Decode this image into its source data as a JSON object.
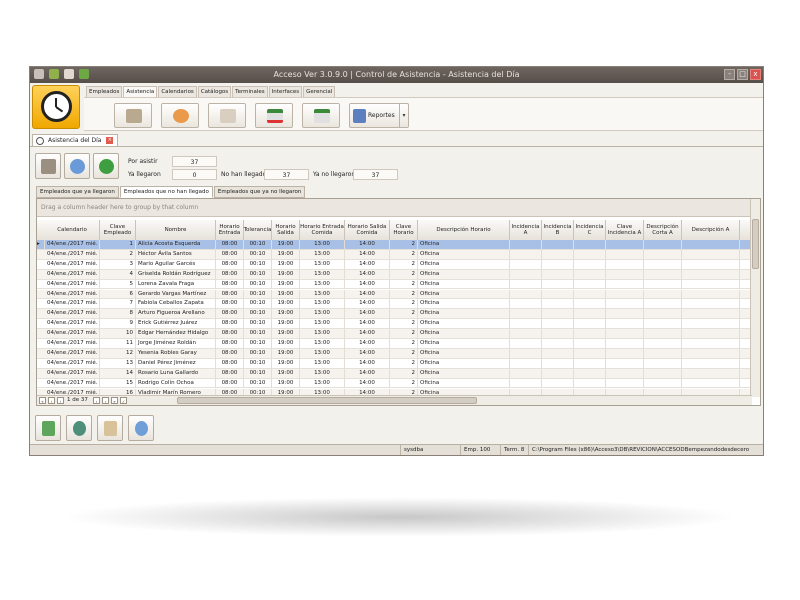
{
  "window": {
    "title": "Acceso Ver 3.0.9.0 | Control de Asistencia - Asistencia del Día",
    "controls": {
      "minimize": "-",
      "maximize": "□",
      "close": "x"
    }
  },
  "ribbon": {
    "tabs": [
      "Empleados",
      "Asistencia",
      "Calendarios",
      "Catálogos",
      "Terminales",
      "Interfaces",
      "Gerencial"
    ],
    "active_tab": "Asistencia",
    "reportes_label": "Reportes"
  },
  "doc_tab": {
    "label": "Asistencia del Día"
  },
  "stats": {
    "por_asistir_label": "Por asistir",
    "por_asistir_value": "37",
    "ya_llegaron_label": "Ya llegaron",
    "ya_llegaron_value": "0",
    "no_han_llegado_label": "No han llegado",
    "no_han_llegado_value": "37",
    "ya_no_llegaron_label": "Ya no llegaron",
    "ya_no_llegaron_value": "37"
  },
  "subtabs": [
    "Empleados que ya llegaron",
    "Empleados que no han llegado",
    "Empleados que ya no llegaron"
  ],
  "active_subtab": "Empleados que no han llegado",
  "grid": {
    "group_hint": "Drag a column header here to group by that column",
    "columns": [
      "Calendario",
      "Clave Empleado",
      "Nombre",
      "Horario Entrada",
      "Tolerancia",
      "Horario Salida",
      "Horario Entrada Comida",
      "Horario Salida Comida",
      "Clave Horario",
      "Descripción Horario",
      "Incidencia A",
      "Incidencia B",
      "Incidencia C",
      "Clave Incidencia A",
      "Descripción Corta A",
      "Descripción A"
    ],
    "rows": [
      [
        "04/ene./2017 mié.",
        "1",
        "Alicia Acosta Esquerda",
        "08:00",
        "00:10",
        "19:00",
        "13:00",
        "14:00",
        "2",
        "Oficina"
      ],
      [
        "04/ene./2017 mié.",
        "2",
        "Héctor Ávila Santos",
        "08:00",
        "00:10",
        "19:00",
        "13:00",
        "14:00",
        "2",
        "Oficina"
      ],
      [
        "04/ene./2017 mié.",
        "3",
        "Mario Aguilar Garcés",
        "08:00",
        "00:10",
        "19:00",
        "13:00",
        "14:00",
        "2",
        "Oficina"
      ],
      [
        "04/ene./2017 mié.",
        "4",
        "Griselda Roldán Rodríguez",
        "08:00",
        "00:10",
        "19:00",
        "13:00",
        "14:00",
        "2",
        "Oficina"
      ],
      [
        "04/ene./2017 mié.",
        "5",
        "Lorena Zavala Fraga",
        "08:00",
        "00:10",
        "19:00",
        "13:00",
        "14:00",
        "2",
        "Oficina"
      ],
      [
        "04/ene./2017 mié.",
        "6",
        "Gerardo Vargas Martínez",
        "08:00",
        "00:10",
        "19:00",
        "13:00",
        "14:00",
        "2",
        "Oficina"
      ],
      [
        "04/ene./2017 mié.",
        "7",
        "Fabiola Ceballos Zapata",
        "08:00",
        "00:10",
        "19:00",
        "13:00",
        "14:00",
        "2",
        "Oficina"
      ],
      [
        "04/ene./2017 mié.",
        "8",
        "Arturo Figueroa Arellano",
        "08:00",
        "00:10",
        "19:00",
        "13:00",
        "14:00",
        "2",
        "Oficina"
      ],
      [
        "04/ene./2017 mié.",
        "9",
        "Erick Gutiérrez Juárez",
        "08:00",
        "00:10",
        "19:00",
        "13:00",
        "14:00",
        "2",
        "Oficina"
      ],
      [
        "04/ene./2017 mié.",
        "10",
        "Edgar Hernández Hidalgo",
        "08:00",
        "00:10",
        "19:00",
        "13:00",
        "14:00",
        "2",
        "Oficina"
      ],
      [
        "04/ene./2017 mié.",
        "11",
        "Jorge Jiménez Roldán",
        "08:00",
        "00:10",
        "19:00",
        "13:00",
        "14:00",
        "2",
        "Oficina"
      ],
      [
        "04/ene./2017 mié.",
        "12",
        "Yesenia Robles Garay",
        "08:00",
        "00:10",
        "19:00",
        "13:00",
        "14:00",
        "2",
        "Oficina"
      ],
      [
        "04/ene./2017 mié.",
        "13",
        "Daniel Pérez Jiménez",
        "08:00",
        "00:10",
        "19:00",
        "13:00",
        "14:00",
        "2",
        "Oficina"
      ],
      [
        "04/ene./2017 mié.",
        "14",
        "Rosario Luna Gallardo",
        "08:00",
        "00:10",
        "19:00",
        "13:00",
        "14:00",
        "2",
        "Oficina"
      ],
      [
        "04/ene./2017 mié.",
        "15",
        "Rodrigo Colín Ochoa",
        "08:00",
        "00:10",
        "19:00",
        "13:00",
        "14:00",
        "2",
        "Oficina"
      ],
      [
        "04/ene./2017 mié.",
        "16",
        "Vladimir Marín Romero",
        "08:00",
        "00:10",
        "19:00",
        "13:00",
        "14:00",
        "2",
        "Oficina"
      ]
    ],
    "selected_row": 0,
    "pager": "1 de 37"
  },
  "statusbar": {
    "user": "sysdba",
    "company": "Emp. 100",
    "terminal": "Term. 8",
    "path": "C:\\Program Files (x86)\\Acceso3\\DB\\REVICION\\ACCESODBempezandodesdecero"
  },
  "colors": {
    "titlebar": "#564e49",
    "selection": "#a9c0e6",
    "appbutton": "#f0a800"
  }
}
